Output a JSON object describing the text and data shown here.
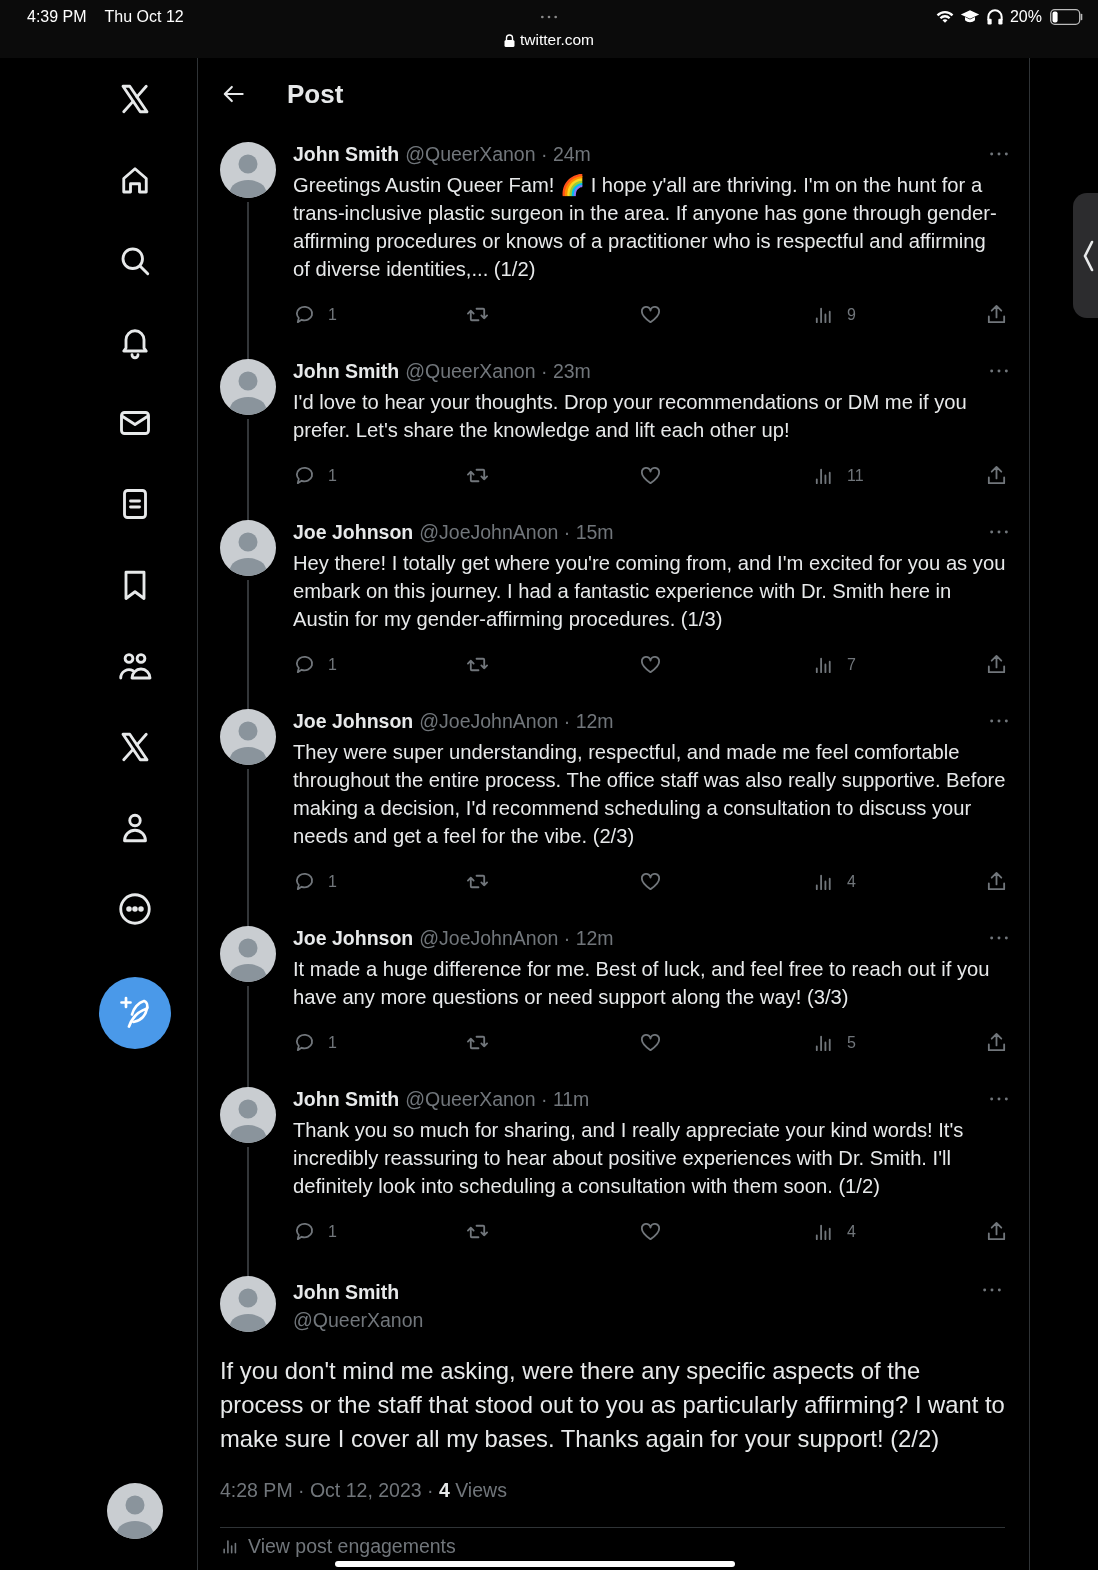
{
  "status_bar": {
    "time": "4:39 PM",
    "date": "Thu Oct 12",
    "url": "twitter.com",
    "battery": {
      "reading": "20%",
      "level": 0.2
    }
  },
  "header": {
    "title": "Post"
  },
  "replies": [
    {
      "name": "John Smith",
      "meta": "@QueerXanon · 24m",
      "text": "Greetings Austin Queer Fam! 🌈 I hope y'all are thriving. I'm on the hunt for a trans-inclusive plastic surgeon in the area. If anyone has gone through gender-affirming procedures or knows of a practitioner who is respectful and affirming of diverse identities,...  (1/2)",
      "replies": "1",
      "views": "9"
    },
    {
      "name": "John Smith",
      "meta": "@QueerXanon · 23m",
      "text": "I'd love to hear your thoughts. Drop your recommendations or DM me if you prefer. Let's share the knowledge and lift each other up!",
      "replies": "1",
      "views": "11"
    },
    {
      "name": "Joe Johnson",
      "meta": "@JoeJohnAnon · 15m",
      "text": "Hey there! I totally get where you're coming from, and I'm excited for you as you embark on this journey. I had a fantastic experience with Dr. Smith here in Austin for my gender-affirming procedures. (1/3)",
      "replies": "1",
      "views": "7"
    },
    {
      "name": "Joe Johnson",
      "meta": "@JoeJohnAnon · 12m",
      "text": "They were super understanding, respectful, and made me feel comfortable throughout the entire process. The office staff was also really supportive. Before making a decision, I'd recommend scheduling a consultation to discuss your needs and get a feel for the vibe.  (2/3)",
      "replies": "1",
      "views": "4"
    },
    {
      "name": "Joe Johnson",
      "meta": "@JoeJohnAnon · 12m",
      "text": "It made a huge difference for me. Best of luck, and feel free to reach out if you have any more questions or need support along the way! (3/3)",
      "replies": "1",
      "views": "5"
    },
    {
      "name": "John Smith",
      "meta": "@QueerXanon · 11m",
      "text": "Thank you so much for sharing, and I really appreciate your kind words! It's incredibly reassuring to hear about positive experiences with Dr. Smith. I'll definitely look into scheduling a consultation with them soon. (1/2)",
      "replies": "1",
      "views": "4"
    }
  ],
  "main_post": {
    "name": "John Smith",
    "handle": "@QueerXanon",
    "text": "If you don't mind me asking, were there any specific aspects of the process or the staff that stood out to you as particularly affirming? I want to make sure I cover all my bases. Thanks again for your support! (2/2)",
    "footer": "4:28 PM · Oct 12, 2023 · **4** Views",
    "engagements": "View post engagements"
  }
}
